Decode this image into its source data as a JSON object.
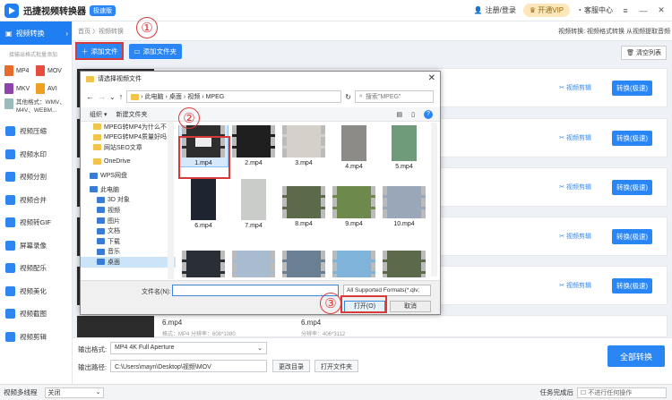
{
  "app": {
    "title": "迅捷视频转换器",
    "badge": "极速版",
    "login": "注册/登录",
    "vip": "开通VIP",
    "service": "客服中心"
  },
  "sidebar": {
    "active": "视频转换",
    "hint": "接输出格式批量添加",
    "formats": [
      "MP4",
      "MOV",
      "MKV",
      "AVI"
    ],
    "other_formats": "其他格式：WMV、M4V、WEBM...",
    "items": [
      "视频压缩",
      "视频水印",
      "视频分割",
      "视频合并",
      "视频转GIF",
      "屏幕录像",
      "视频配乐",
      "视频美化",
      "视频截图",
      "视频剪辑"
    ]
  },
  "main": {
    "breadcrumb": "首页 〉视频转换",
    "breadcrumb_right": "视频转换: 视频格式转换 从视频提取音频",
    "add_file": "添加文件",
    "add_folder": "添加文件夹",
    "clear": "清空列表",
    "row_op": "视频剪辑",
    "row_convert": "转换(极速)",
    "row_filename": "6.mp4",
    "row_filename2": "6.mp4",
    "row_meta1": "格式：MP4   分辨率：608*1080",
    "row_meta2": "分辨率：406*3112"
  },
  "bottom": {
    "format_label": "输出格式:",
    "format_value": "MP4  4K Full Aperture",
    "path_label": "输出路径:",
    "path_value": "C:\\Users\\mayn\\Desktop\\视频\\MOV",
    "change_dir": "更改目录",
    "open_folder": "打开文件夹",
    "convert_all": "全部转换"
  },
  "status": {
    "multithread_label": "视频多线程",
    "multithread_value": "关闭",
    "task_done": "任务完成后",
    "no_action": "不进行任何操作"
  },
  "dialog": {
    "title": "请选择视频文件",
    "path": [
      "此电脑",
      "桌面",
      "视频",
      "MPEG"
    ],
    "search_placeholder": "搜索\"MPEG\"",
    "organize": "组织 ▾",
    "new_folder": "新建文件夹",
    "nav": [
      "MPEG转MP4为什么不",
      "MPEG转MP4质量好吗",
      "网站SEO文章",
      "OneDrive",
      "WPS网盘",
      "此电脑",
      "3D 对象",
      "视频",
      "图片",
      "文档",
      "下载",
      "音乐",
      "桌面"
    ],
    "files": [
      "1.mp4",
      "2.mp4",
      "3.mp4",
      "4.mp4",
      "5.mp4",
      "6.mp4",
      "7.mp4",
      "8.mp4",
      "9.mp4",
      "10.mp4"
    ],
    "filename_label": "文件名(N):",
    "filetype": "All Supported Formats(*.qlv;",
    "open": "打开(O)",
    "cancel": "取消"
  },
  "annotations": {
    "c1": "①",
    "c2": "②",
    "c3": "③"
  }
}
